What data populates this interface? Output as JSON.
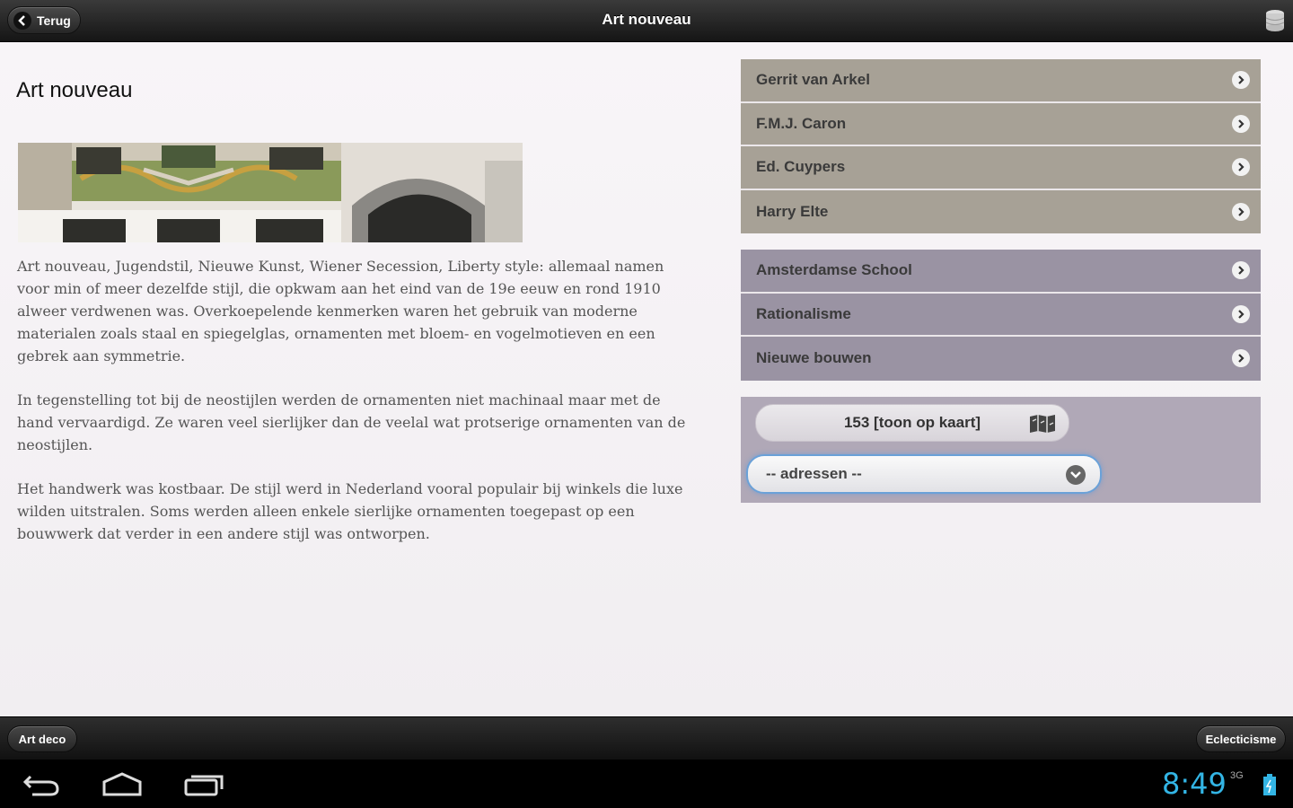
{
  "header": {
    "back_label": "Terug",
    "title": "Art nouveau",
    "db_icon": "database-icon"
  },
  "main": {
    "title": "Art nouveau",
    "paragraphs": [
      "Art nouveau, Jugendstil, Nieuwe Kunst, Wiener Secession, Liberty style: allemaal namen voor min of meer dezelfde stijl, die opkwam aan het eind van de 19e eeuw en rond 1910 alweer verdwenen was. Overkoepelende kenmerken waren het gebruik van moderne materialen zoals staal en spiegelglas, ornamenten met bloem- en vogelmotieven en een gebrek aan symmetrie.",
      "In tegenstelling tot bij de neostijlen werden de ornamenten niet machinaal maar met de hand vervaardigd. Ze waren veel sierlijker dan de veelal wat protserige ornamenten van de neostijlen.",
      "Het handwerk was kostbaar. De stijl werd in Nederland vooral populair bij winkels die luxe wilden uitstralen. Soms werden alleen enkele sierlijke ornamenten toegepast op een bouwwerk dat verder in een andere stijl was ontworpen."
    ]
  },
  "architects": [
    {
      "label": "Gerrit van Arkel"
    },
    {
      "label": "F.M.J. Caron"
    },
    {
      "label": "Ed. Cuypers"
    },
    {
      "label": "Harry Elte"
    }
  ],
  "styles": [
    {
      "label": "Amsterdamse School"
    },
    {
      "label": "Rationalisme"
    },
    {
      "label": "Nieuwe bouwen"
    }
  ],
  "panel": {
    "map_button_label": "153 [toon op kaart]",
    "select_value": "-- adressen --"
  },
  "footer": {
    "prev_label": "Art deco",
    "next_label": "Eclecticisme"
  },
  "statusbar": {
    "time": "8:49",
    "signal": "3G"
  },
  "colors": {
    "architect_item_bg": "#a7a196",
    "style_item_bg": "#9a93a3",
    "panel_bg": "#b0a8b7",
    "clock": "#33b5e5"
  }
}
